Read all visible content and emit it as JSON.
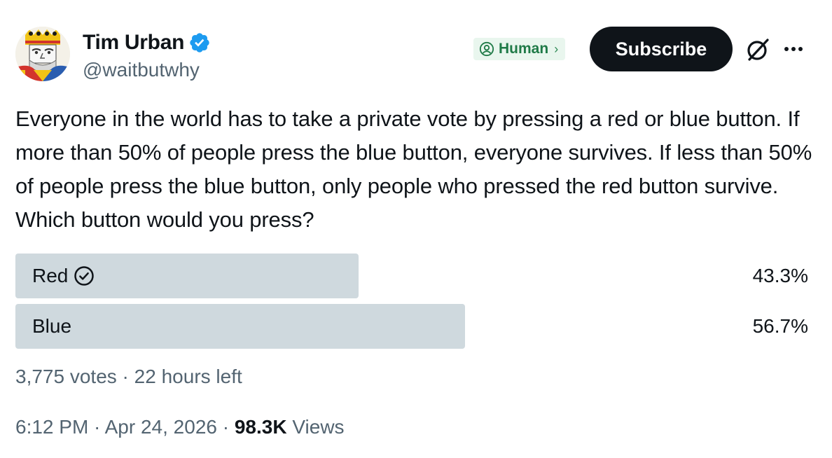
{
  "author": {
    "name": "Tim Urban",
    "handle": "@waitbutwhy",
    "avatar_icon": "king-playing-card-avatar",
    "verified_icon": "verified-badge-icon",
    "verified_color": "#1d9bf0"
  },
  "actions": {
    "human_badge_label": "Human",
    "human_badge_chevron": "›",
    "subscribe_label": "Subscribe",
    "grok_icon": "grok-icon",
    "more_icon": "more-icon"
  },
  "tweet": {
    "text": "Everyone in the world has to take a private vote by pressing a red or blue button. If more than 50% of people press the blue button, everyone survives. If less than 50% of people press the blue button, only people who pressed the red button survive. Which button would you press?"
  },
  "poll": {
    "options": [
      {
        "label": "Red",
        "percent": "43.3%",
        "fraction": 0.433,
        "selected": true
      },
      {
        "label": "Blue",
        "percent": "56.7%",
        "fraction": 0.567,
        "selected": false
      }
    ],
    "votes": "3,775 votes",
    "separator": " · ",
    "time_left": "22 hours left",
    "bar_color": "#cfd9de"
  },
  "meta": {
    "time": "6:12 PM",
    "separator": " · ",
    "date": "Apr 24, 2026",
    "views_count": "98.3K",
    "views_label": "Views"
  },
  "colors": {
    "text_primary": "#0f1419",
    "text_secondary": "#536471",
    "human_badge_bg": "#e9f6ee",
    "human_badge_text": "#1f7a47",
    "subscribe_bg": "#0f1419"
  }
}
